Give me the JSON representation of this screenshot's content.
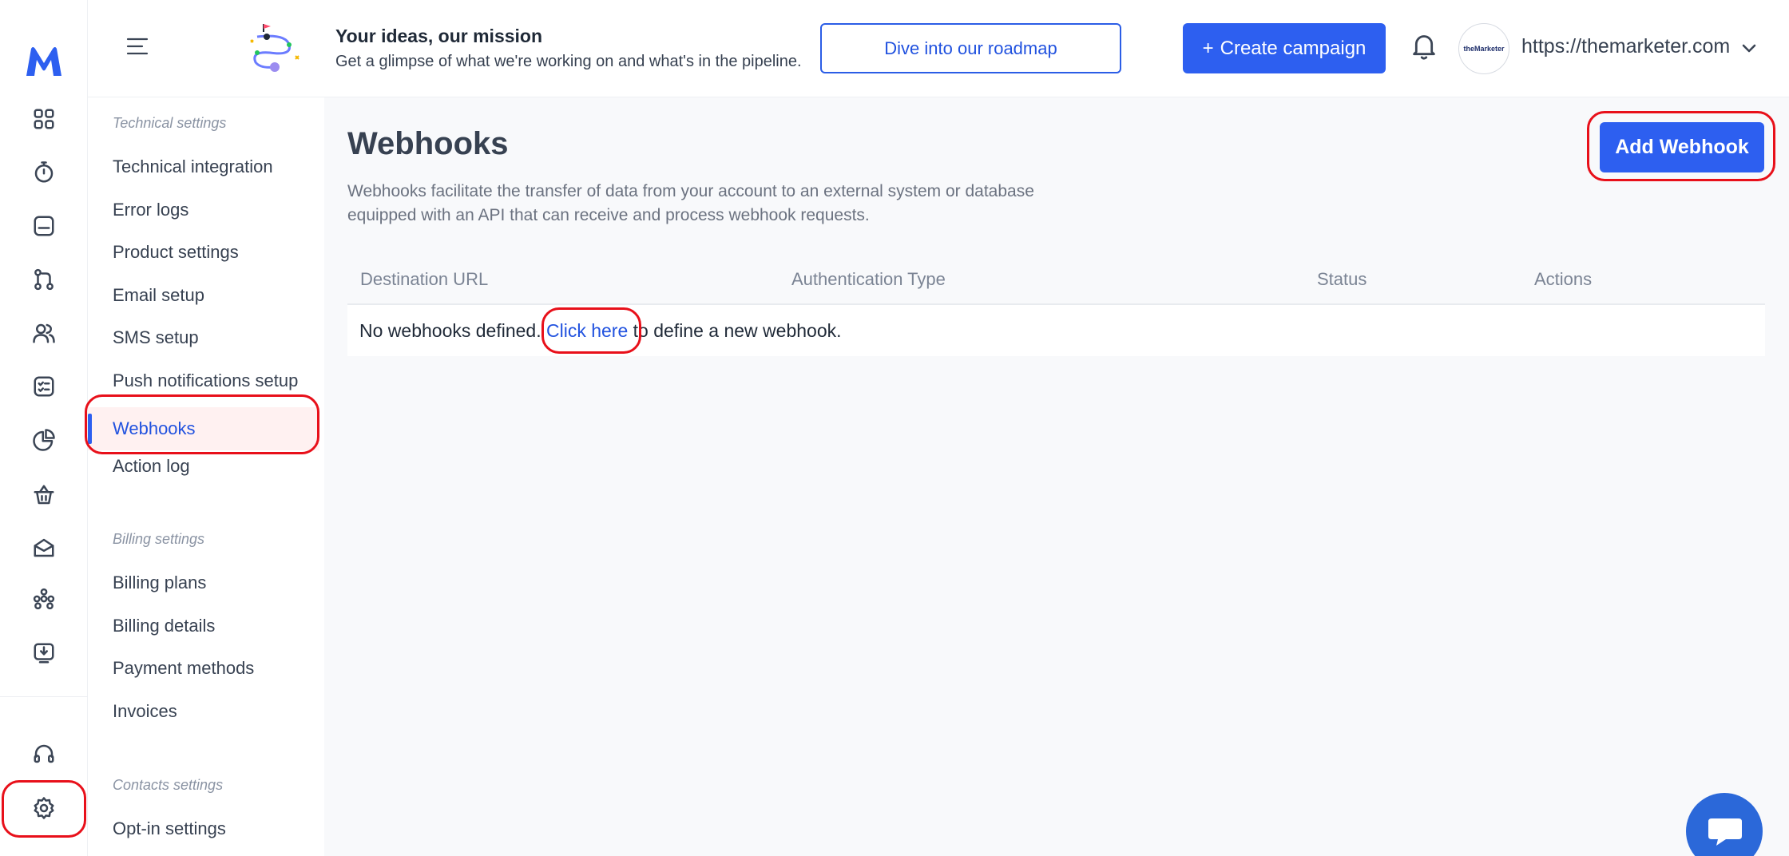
{
  "rail": {
    "logo": "logo-icon",
    "items": [
      "dashboard-icon",
      "stopwatch-icon",
      "inbox-icon",
      "workflow-icon",
      "contacts-icon",
      "tasks-icon",
      "reports-icon",
      "basket-icon",
      "email-icon",
      "segments-icon",
      "download-icon"
    ],
    "bottom": [
      "headset-icon",
      "gear-icon"
    ]
  },
  "header": {
    "promo_title": "Your ideas, our mission",
    "promo_subtitle": "Get a glimpse of what we're working on and what's in the pipeline.",
    "roadmap_label": "Dive into our roadmap",
    "create_label": "Create campaign",
    "create_prefix": "+",
    "avatar_text": "theMarketer",
    "domain": "https://themarketer.com"
  },
  "sidebar": {
    "groups": [
      {
        "title": "Technical settings",
        "items": [
          "Technical integration",
          "Error logs",
          "Product settings",
          "Email setup",
          "SMS setup",
          "Push notifications setup",
          "Webhooks",
          "Action log"
        ]
      },
      {
        "title": "Billing settings",
        "items": [
          "Billing plans",
          "Billing details",
          "Payment methods",
          "Invoices"
        ]
      },
      {
        "title": "Contacts settings",
        "items": [
          "Opt-in settings"
        ]
      }
    ],
    "active": "Webhooks"
  },
  "main": {
    "title": "Webhooks",
    "description": "Webhooks facilitate the transfer of data from your account to an external system or database equipped with an API that can receive and process webhook requests.",
    "add_label": "Add Webhook",
    "columns": [
      "Destination URL",
      "Authentication Type",
      "Status",
      "Actions"
    ],
    "empty_prefix": "No webhooks defined. ",
    "empty_link": "Click here",
    "empty_suffix": " to define a new webhook."
  },
  "colors": {
    "accent": "#2d5ff0",
    "annotation": "#e8101a",
    "chat": "#2b68d9"
  }
}
